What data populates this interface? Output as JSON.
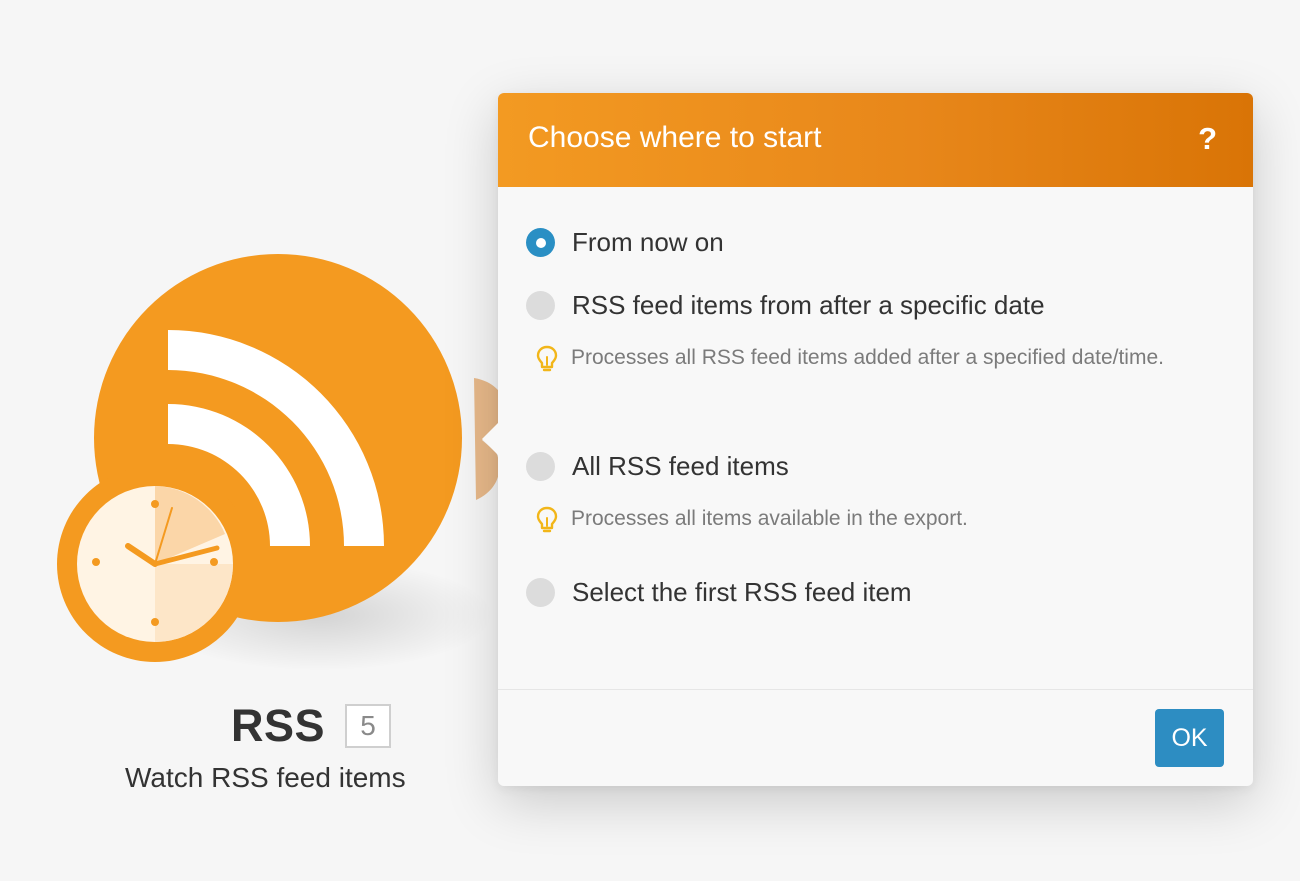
{
  "module": {
    "icon": "rss-clock-icon",
    "name": "RSS",
    "id_badge": "5",
    "subtitle": "Watch RSS feed items",
    "colors": {
      "accent": "#f39a22"
    }
  },
  "dialog": {
    "title": "Choose where to start",
    "help_label": "?",
    "options": [
      {
        "label": "From now on",
        "checked": true
      },
      {
        "label": "RSS feed items from after a specific date",
        "checked": false
      },
      {
        "label": "All RSS feed items",
        "checked": false
      },
      {
        "label": "Select the first RSS feed item",
        "checked": false
      }
    ],
    "hints": [
      {
        "text": "Processes all RSS feed items added after a specified date/time."
      },
      {
        "text": "Processes all items available in the export."
      }
    ],
    "ok_label": "OK",
    "colors": {
      "header": "#f39a22",
      "primary": "#2d8dc2",
      "hint_icon": "#f2b619"
    }
  }
}
